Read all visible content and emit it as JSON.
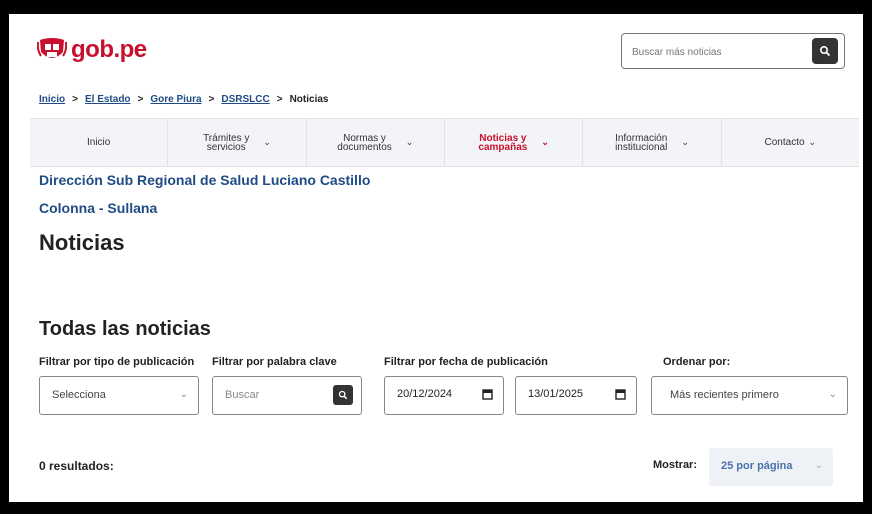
{
  "header": {
    "logo_text": "gob.pe",
    "search_placeholder": "Buscar más noticias"
  },
  "breadcrumb": {
    "items": [
      "Inicio",
      "El Estado",
      "Gore Piura",
      "DSRSLCC"
    ],
    "current": "Noticias"
  },
  "nav": {
    "items": [
      {
        "line1": "Inicio",
        "line2": "",
        "chevron": false
      },
      {
        "line1": "Trámites y",
        "line2": "servicios",
        "chevron": true
      },
      {
        "line1": "Normas y",
        "line2": "documentos",
        "chevron": true
      },
      {
        "line1": "Noticias y",
        "line2": "campañas",
        "chevron": true
      },
      {
        "line1": "Información",
        "line2": "institucional",
        "chevron": true
      },
      {
        "line1": "Contacto",
        "line2": "",
        "chevron": true
      }
    ],
    "active_index": 3
  },
  "entity": {
    "line1": "Dirección Sub Regional de Salud Luciano Castillo",
    "line2": "Colonna - Sullana"
  },
  "page_title": "Noticias",
  "section_title": "Todas las noticias",
  "filters": {
    "type_label": "Filtrar por tipo de publicación",
    "type_value": "Selecciona",
    "keyword_label": "Filtrar por palabra clave",
    "keyword_placeholder": "Buscar",
    "date_label": "Filtrar por fecha de publicación",
    "date_from": "20/12/2024",
    "date_to": "13/01/2025",
    "order_label": "Ordenar por:",
    "order_value": "Más recientes primero"
  },
  "results_text": "0 resultados:",
  "show": {
    "label": "Mostrar:",
    "value": "25 por página"
  },
  "colors": {
    "brand_red": "#c8102e",
    "link_blue": "#1f4b86",
    "nav_bg": "#f3f4f7"
  },
  "icons": [
    "search-icon",
    "calendar-icon",
    "chevron-down-icon"
  ]
}
